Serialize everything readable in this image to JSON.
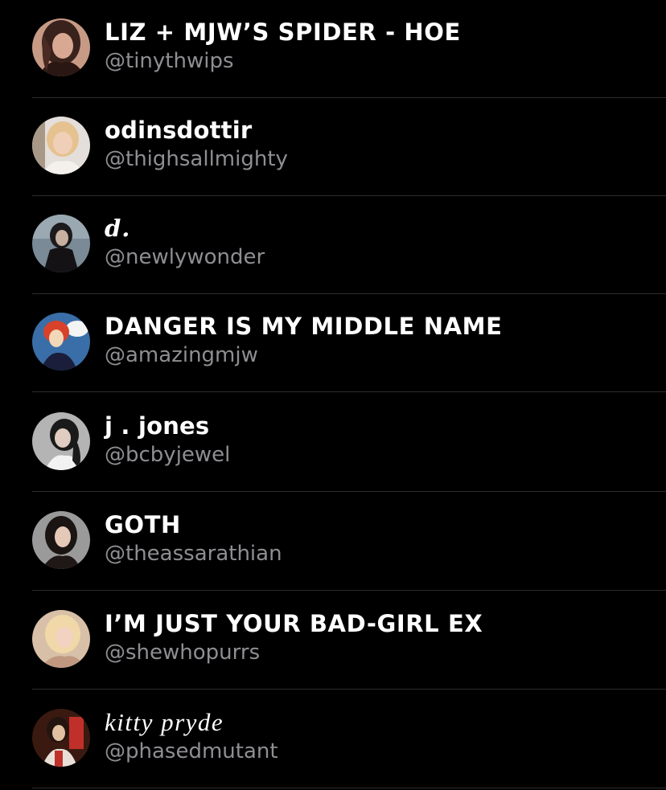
{
  "users": [
    {
      "name": "LIZ + MJW’S SPIDER - HOE",
      "handle": "@tinythwips",
      "avatar_icon": "profile-photo-avatar",
      "colors": [
        "#6a4a3e",
        "#c79a86",
        "#2a1612"
      ]
    },
    {
      "name": "odinsdottir",
      "handle": "@thighsallmighty",
      "avatar_icon": "profile-photo-avatar",
      "colors": [
        "#d8d2cc",
        "#e8c49a",
        "#8a6a52"
      ]
    },
    {
      "name": "d.",
      "handle": "@newlywonder",
      "avatar_icon": "profile-photo-avatar",
      "colors": [
        "#7a8a96",
        "#1c1a1c",
        "#c8b0a0"
      ]
    },
    {
      "name": "DANGER IS MY MIDDLE NAME",
      "handle": "@amazingmjw",
      "avatar_icon": "comic-avatar",
      "colors": [
        "#3a6ea8",
        "#d8422a",
        "#f0d8b8"
      ]
    },
    {
      "name": "j . jones",
      "handle": "@bcbyjewel",
      "avatar_icon": "profile-photo-avatar",
      "colors": [
        "#b0b0b0",
        "#1a1a1a",
        "#e0ccc0"
      ]
    },
    {
      "name": "GOTH",
      "handle": "@theassarathian",
      "avatar_icon": "profile-photo-avatar",
      "colors": [
        "#9a9a9a",
        "#1a1412",
        "#e4c8b8"
      ]
    },
    {
      "name": "I’M JUST YOUR BAD-GIRL EX",
      "handle": "@shewhopurrs",
      "avatar_icon": "profile-photo-avatar",
      "colors": [
        "#d8c0a8",
        "#f0d8a8",
        "#c09880"
      ]
    },
    {
      "name": "kitty pryde",
      "handle": "@phasedmutant",
      "avatar_icon": "comic-avatar",
      "colors": [
        "#3a1a10",
        "#c0302a",
        "#e0c0a0"
      ]
    }
  ]
}
